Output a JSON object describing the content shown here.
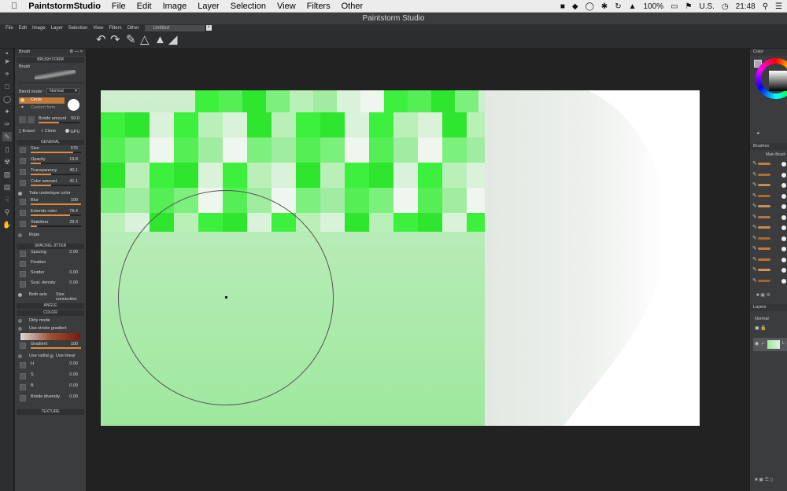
{
  "macmenu": {
    "app_name": "PaintstormStudio",
    "items": [
      "File",
      "Edit",
      "Image",
      "Layer",
      "Selection",
      "View",
      "Filters",
      "Other"
    ],
    "status": {
      "battery": "100%",
      "input": "U.S.",
      "clock": "21:48"
    }
  },
  "window": {
    "title": "Paintstorm Studio"
  },
  "appmenu": {
    "items": [
      "File",
      "Edit",
      "Image",
      "Layer",
      "Selection",
      "View",
      "Filters",
      "Other"
    ],
    "doc_tab": "Untitled"
  },
  "brush_panel": {
    "title": "Brush",
    "brush_form_header": "BRUSH FORM",
    "brush_label": "Brush",
    "blend_mode_label": "Blend mode:",
    "blend_mode_value": "Normal",
    "shape_circle": "Circle",
    "shape_custom": "Custom form",
    "bristle_label": "Bristle amount",
    "bristle_value": "50.0",
    "eraser_label": "Eraser",
    "clone_label": "Clone",
    "gpu_label": "GPU",
    "general_header": "GENERAL",
    "general": [
      {
        "label": "Size",
        "value": "576",
        "fill": 0.85
      },
      {
        "label": "Opacity",
        "value": "19.8",
        "fill": 0.2
      },
      {
        "label": "Transparency",
        "value": "40.1",
        "fill": 0.4
      },
      {
        "label": "Color amount",
        "value": "41.1",
        "fill": 0.41
      }
    ],
    "take_underlayer": "Take underlayer color",
    "general2": [
      {
        "label": "Blur",
        "value": "100",
        "fill": 1.0
      },
      {
        "label": "Extends color",
        "value": "78.4",
        "fill": 0.78
      },
      {
        "label": "Stabilizer",
        "value": "29.3",
        "fill": 0.12
      }
    ],
    "rope_label": "Rope",
    "spacing_header": "SPACING JITTER",
    "spacing": [
      {
        "label": "Spacing",
        "value": "0.00"
      },
      {
        "label": "Fixation",
        "value": ""
      },
      {
        "label": "Scatter",
        "value": "0.00"
      },
      {
        "label": "Scat. density",
        "value": "0.00"
      }
    ],
    "both_axis": "Both axis",
    "size_connection": "Size connection",
    "angle_header": "ANGLE",
    "color_header": "COLOR",
    "dirty_mode": "Dirty mode",
    "use_stroke_gradient": "Use stroke gradient",
    "gradient_label": "Gradient",
    "gradient_value": "100",
    "use_radial": "Use radial",
    "use_linear": "Use linear",
    "hsb": [
      {
        "label": "H",
        "value": "0.00"
      },
      {
        "label": "S",
        "value": "0.00"
      },
      {
        "label": "B",
        "value": "0.00"
      }
    ],
    "bristle_diversity_label": "Bristle diversity",
    "bristle_diversity_value": "0.00",
    "texture_header": "TEXTURE"
  },
  "right_panel": {
    "color_title": "Color",
    "brushes_title": "Brushes",
    "main_brushes": "Main Brush",
    "layers_title": "Layers",
    "layer_blend": "Normal",
    "layer_name": "L"
  },
  "colors": {
    "accent": "#e08a3d",
    "canvas_green": "#3ff03f",
    "panel": "#3a3c3e"
  }
}
